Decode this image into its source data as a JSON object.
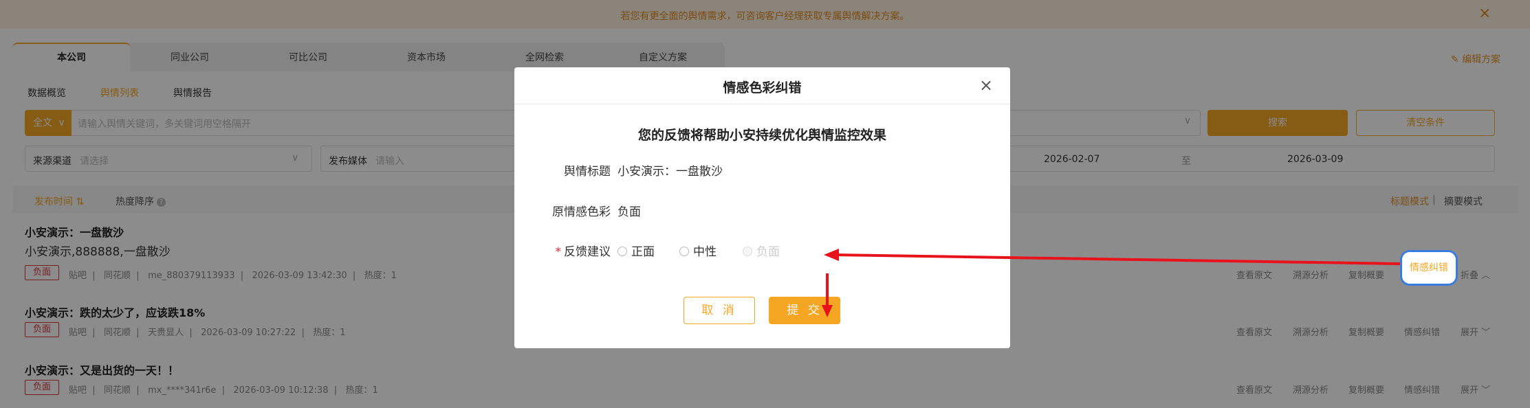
{
  "notice": {
    "text": "若您有更全面的舆情需求，可咨询客户经理获取专属舆情解决方案。",
    "close_icon": "×"
  },
  "tabs": [
    {
      "label": "本公司",
      "active": true
    },
    {
      "label": "同业公司"
    },
    {
      "label": "可比公司"
    },
    {
      "label": "资本市场"
    },
    {
      "label": "全网检索"
    },
    {
      "label": "自定义方案"
    }
  ],
  "edit_plan": "编辑方案",
  "subtabs": [
    {
      "label": "数据概览"
    },
    {
      "label": "舆情列表",
      "active": true
    },
    {
      "label": "舆情报告"
    }
  ],
  "search": {
    "scope": "全文",
    "placeholder": "请输入舆情关键词，多关键词用空格隔开",
    "search_button": "搜索",
    "clear_button": "清空条件"
  },
  "filters": {
    "source_label": "来源渠道",
    "source_placeholder": "请选择",
    "media_label": "发布媒体",
    "media_placeholder": "请输入",
    "date_from": "2026-02-07",
    "date_sep": "至",
    "date_to": "2026-03-09"
  },
  "sort": {
    "publish_time": "发布时间 ⇅",
    "hot_desc": "热度降序",
    "help": "?",
    "mode_title": "标题模式",
    "mode_sep": "|",
    "mode_summary": "摘要模式"
  },
  "items": [
    {
      "title": "小安演示：一盘散沙",
      "summary": "小安演示,888888,一盘散沙",
      "sentiment": "负面",
      "meta": "贴吧  |   同花顺  |   me_880379113933  |   2026-03-09 13:42:30  |   热度：1",
      "actions": [
        "查看原文",
        "溯源分析",
        "复制概要",
        "情感纠错"
      ],
      "fold": "折叠"
    },
    {
      "title": "小安演示：跌的太少了，应该跌18%",
      "sentiment": "负面",
      "meta": "贴吧  |   同花顺  |   天贵显人  |   2026-03-09 10:27:22  |   热度：1",
      "actions": [
        "查看原文",
        "溯源分析",
        "复制概要",
        "情感纠错"
      ],
      "fold": "展开"
    },
    {
      "title": "小安演示：又是出货的一天！！",
      "sentiment": "负面",
      "meta": "贴吧  |   同花顺  |   mx_****341r6e  |   2026-03-09 10:12:38  |   热度：1",
      "actions": [
        "查看原文",
        "溯源分析",
        "复制概要",
        "情感纠错"
      ],
      "fold": "展开"
    }
  ],
  "dialog": {
    "title": "情感色彩纠错",
    "close_icon": "×",
    "subtitle": "您的反馈将帮助小安持续优化舆情监控效果",
    "field_title_label": "舆情标题",
    "field_title_value": "小安演示：一盘散沙",
    "field_orig_label": "原情感色彩",
    "field_orig_value": "负面",
    "field_feedback_label": "反馈建议",
    "required_mark": "*",
    "options": [
      "正面",
      "中性",
      "负面"
    ],
    "cancel": "取 消",
    "submit": "提 交"
  },
  "colors": {
    "accent": "#f5a623",
    "negative": "#d9363e",
    "highlight": "#3a7be0",
    "arrow": "#e8121b"
  }
}
